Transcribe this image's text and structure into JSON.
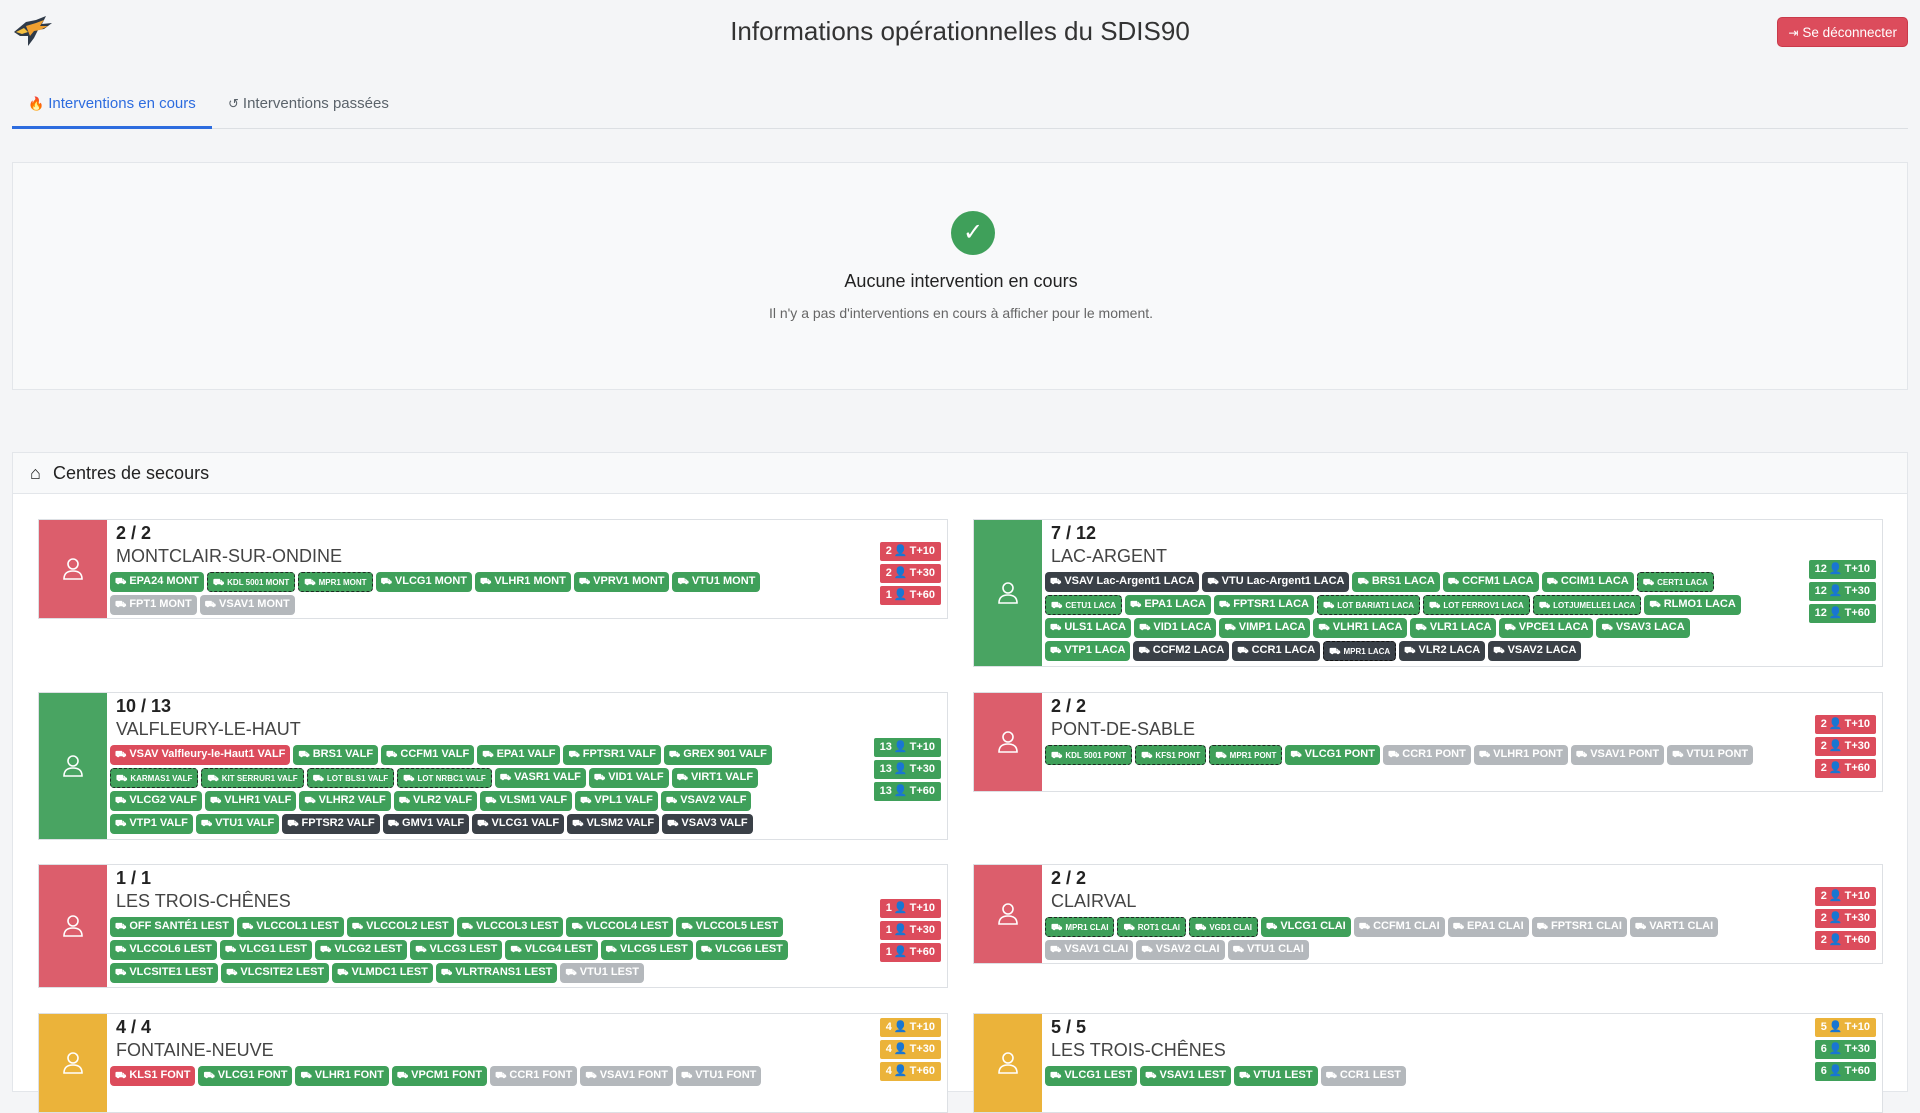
{
  "header": {
    "title": "Informations opérationnelles du SDIS90",
    "logout_label": "Se déconnecter"
  },
  "tabs": [
    {
      "label": "Interventions en cours"
    },
    {
      "label": "Interventions passées"
    }
  ],
  "empty": {
    "title": "Aucune intervention en cours",
    "subtitle": "Il n'y a pas d'interventions en cours à afficher pour le moment."
  },
  "centres": {
    "title": "Centres de secours",
    "cards": [
      {
        "count": "2 / 2",
        "name": "MONTCLAIR-SUR-ONDINE",
        "status": "red",
        "vehicles": [
          {
            "label": "EPA24 MONT",
            "color": "green"
          },
          {
            "label": "KDL 5001 MONT",
            "color": "dashed",
            "small": true
          },
          {
            "label": "MPR1 MONT",
            "color": "dashed",
            "small": true
          },
          {
            "label": "VLCG1 MONT",
            "color": "green"
          },
          {
            "label": "VLHR1 MONT",
            "color": "green"
          },
          {
            "label": "VPRV1 MONT",
            "color": "green"
          },
          {
            "label": "VTU1 MONT",
            "color": "green"
          },
          {
            "label": "FPT1 MONT",
            "color": "gray"
          },
          {
            "label": "VSAV1 MONT",
            "color": "gray"
          }
        ],
        "staff": [
          {
            "n": "2",
            "t": "T+10",
            "color": "red"
          },
          {
            "n": "2",
            "t": "T+30",
            "color": "red"
          },
          {
            "n": "1",
            "t": "T+60",
            "color": "red"
          }
        ]
      },
      {
        "count": "7 / 12",
        "name": "LAC-ARGENT",
        "status": "green",
        "vehicles": [
          {
            "label": "VSAV Lac-Argent1 LACA",
            "color": "dark"
          },
          {
            "label": "VTU Lac-Argent1 LACA",
            "color": "dark"
          },
          {
            "label": "BRS1 LACA",
            "color": "green"
          },
          {
            "label": "CCFM1 LACA",
            "color": "green"
          },
          {
            "label": "CCIM1 LACA",
            "color": "green"
          },
          {
            "label": "CERT1 LACA",
            "color": "dashed",
            "small": true
          },
          {
            "label": "CETU1 LACA",
            "color": "dashed",
            "small": true
          },
          {
            "label": "EPA1 LACA",
            "color": "green"
          },
          {
            "label": "FPTSR1 LACA",
            "color": "green"
          },
          {
            "label": "LOT BARIAT1 LACA",
            "color": "dashed",
            "small": true
          },
          {
            "label": "LOT FERROV1 LACA",
            "color": "dashed",
            "small": true
          },
          {
            "label": "LOTJUMELLE1 LACA",
            "color": "dashed",
            "small": true
          },
          {
            "label": "RLMO1 LACA",
            "color": "green"
          },
          {
            "label": "ULS1 LACA",
            "color": "green"
          },
          {
            "label": "VID1 LACA",
            "color": "green"
          },
          {
            "label": "VIMP1 LACA",
            "color": "green"
          },
          {
            "label": "VLHR1 LACA",
            "color": "green"
          },
          {
            "label": "VLR1 LACA",
            "color": "green"
          },
          {
            "label": "VPCE1 LACA",
            "color": "green"
          },
          {
            "label": "VSAV3 LACA",
            "color": "green"
          },
          {
            "label": "VTP1 LACA",
            "color": "green"
          },
          {
            "label": "CCFM2 LACA",
            "color": "dark"
          },
          {
            "label": "CCR1 LACA",
            "color": "dark"
          },
          {
            "label": "MPR1 LACA",
            "color": "dashed-dk",
            "small": true
          },
          {
            "label": "VLR2 LACA",
            "color": "dark"
          },
          {
            "label": "VSAV2 LACA",
            "color": "dark"
          }
        ],
        "staff": [
          {
            "n": "12",
            "t": "T+10",
            "color": "green"
          },
          {
            "n": "12",
            "t": "T+30",
            "color": "green"
          },
          {
            "n": "12",
            "t": "T+60",
            "color": "green"
          }
        ]
      },
      {
        "count": "10 / 13",
        "name": "VALFLEURY-LE-HAUT",
        "status": "green",
        "vehicles": [
          {
            "label": "VSAV Valfleury-le-Haut1 VALF",
            "color": "red"
          },
          {
            "label": "BRS1 VALF",
            "color": "green"
          },
          {
            "label": "CCFM1 VALF",
            "color": "green"
          },
          {
            "label": "EPA1 VALF",
            "color": "green"
          },
          {
            "label": "FPTSR1 VALF",
            "color": "green"
          },
          {
            "label": "GREX 901 VALF",
            "color": "green"
          },
          {
            "label": "KARMAS1 VALF",
            "color": "dashed",
            "small": true
          },
          {
            "label": "KIT SERRUR1 VALF",
            "color": "dashed",
            "small": true
          },
          {
            "label": "LOT BLS1 VALF",
            "color": "dashed",
            "small": true
          },
          {
            "label": "LOT NRBC1 VALF",
            "color": "dashed",
            "small": true
          },
          {
            "label": "VASR1 VALF",
            "color": "green"
          },
          {
            "label": "VID1 VALF",
            "color": "green"
          },
          {
            "label": "VIRT1 VALF",
            "color": "green"
          },
          {
            "label": "VLCG2 VALF",
            "color": "green"
          },
          {
            "label": "VLHR1 VALF",
            "color": "green"
          },
          {
            "label": "VLHR2 VALF",
            "color": "green"
          },
          {
            "label": "VLR2 VALF",
            "color": "green"
          },
          {
            "label": "VLSM1 VALF",
            "color": "green"
          },
          {
            "label": "VPL1 VALF",
            "color": "green"
          },
          {
            "label": "VSAV2 VALF",
            "color": "green"
          },
          {
            "label": "VTP1 VALF",
            "color": "green"
          },
          {
            "label": "VTU1 VALF",
            "color": "green"
          },
          {
            "label": "FPTSR2 VALF",
            "color": "dark"
          },
          {
            "label": "GMV1 VALF",
            "color": "dark"
          },
          {
            "label": "VLCG1 VALF",
            "color": "dark"
          },
          {
            "label": "VLSM2 VALF",
            "color": "dark"
          },
          {
            "label": "VSAV3 VALF",
            "color": "dark"
          }
        ],
        "staff": [
          {
            "n": "13",
            "t": "T+10",
            "color": "green"
          },
          {
            "n": "13",
            "t": "T+30",
            "color": "green"
          },
          {
            "n": "13",
            "t": "T+60",
            "color": "green"
          }
        ]
      },
      {
        "count": "2 / 2",
        "name": "PONT-DE-SABLE",
        "status": "red",
        "vehicles": [
          {
            "label": "KDL 5001 PONT",
            "color": "dashed",
            "small": true
          },
          {
            "label": "KFS1 PONT",
            "color": "dashed",
            "small": true
          },
          {
            "label": "MPR1 PONT",
            "color": "dashed",
            "small": true
          },
          {
            "label": "VLCG1 PONT",
            "color": "green"
          },
          {
            "label": "CCR1 PONT",
            "color": "gray"
          },
          {
            "label": "VLHR1 PONT",
            "color": "gray"
          },
          {
            "label": "VSAV1 PONT",
            "color": "gray"
          },
          {
            "label": "VTU1 PONT",
            "color": "gray"
          }
        ],
        "staff": [
          {
            "n": "2",
            "t": "T+10",
            "color": "red"
          },
          {
            "n": "2",
            "t": "T+30",
            "color": "red"
          },
          {
            "n": "2",
            "t": "T+60",
            "color": "red"
          }
        ]
      },
      {
        "count": "1 / 1",
        "name": "LES TROIS-CHÊNES",
        "status": "red",
        "vehicles": [
          {
            "label": "OFF SANTÉ1 LEST",
            "color": "green"
          },
          {
            "label": "VLCCOL1 LEST",
            "color": "green"
          },
          {
            "label": "VLCCOL2 LEST",
            "color": "green"
          },
          {
            "label": "VLCCOL3 LEST",
            "color": "green"
          },
          {
            "label": "VLCCOL4 LEST",
            "color": "green"
          },
          {
            "label": "VLCCOL5 LEST",
            "color": "green"
          },
          {
            "label": "VLCCOL6 LEST",
            "color": "green"
          },
          {
            "label": "VLCG1 LEST",
            "color": "green"
          },
          {
            "label": "VLCG2 LEST",
            "color": "green"
          },
          {
            "label": "VLCG3 LEST",
            "color": "green"
          },
          {
            "label": "VLCG4 LEST",
            "color": "green"
          },
          {
            "label": "VLCG5 LEST",
            "color": "green"
          },
          {
            "label": "VLCG6 LEST",
            "color": "green"
          },
          {
            "label": "VLCSITE1 LEST",
            "color": "green"
          },
          {
            "label": "VLCSITE2 LEST",
            "color": "green"
          },
          {
            "label": "VLMDC1 LEST",
            "color": "green"
          },
          {
            "label": "VLRTRANS1 LEST",
            "color": "green"
          },
          {
            "label": "VTU1 LEST",
            "color": "gray"
          }
        ],
        "staff": [
          {
            "n": "1",
            "t": "T+10",
            "color": "red"
          },
          {
            "n": "1",
            "t": "T+30",
            "color": "red"
          },
          {
            "n": "1",
            "t": "T+60",
            "color": "red"
          }
        ]
      },
      {
        "count": "2 / 2",
        "name": "CLAIRVAL",
        "status": "red",
        "vehicles": [
          {
            "label": "MPR1 CLAI",
            "color": "dashed",
            "small": true
          },
          {
            "label": "ROT1 CLAI",
            "color": "dashed",
            "small": true
          },
          {
            "label": "VGD1 CLAI",
            "color": "dashed",
            "small": true
          },
          {
            "label": "VLCG1 CLAI",
            "color": "green"
          },
          {
            "label": "CCFM1 CLAI",
            "color": "gray"
          },
          {
            "label": "EPA1 CLAI",
            "color": "gray"
          },
          {
            "label": "FPTSR1 CLAI",
            "color": "gray"
          },
          {
            "label": "VART1 CLAI",
            "color": "gray"
          },
          {
            "label": "VSAV1 CLAI",
            "color": "gray"
          },
          {
            "label": "VSAV2 CLAI",
            "color": "gray"
          },
          {
            "label": "VTU1 CLAI",
            "color": "gray"
          }
        ],
        "staff": [
          {
            "n": "2",
            "t": "T+10",
            "color": "red"
          },
          {
            "n": "2",
            "t": "T+30",
            "color": "red"
          },
          {
            "n": "2",
            "t": "T+60",
            "color": "red"
          }
        ]
      },
      {
        "count": "4 / 4",
        "name": "FONTAINE-NEUVE",
        "status": "orange",
        "vehicles": [
          {
            "label": "KLS1 FONT",
            "color": "red"
          },
          {
            "label": "VLCG1 FONT",
            "color": "green"
          },
          {
            "label": "VLHR1 FONT",
            "color": "green"
          },
          {
            "label": "VPCM1 FONT",
            "color": "green"
          },
          {
            "label": "CCR1 FONT",
            "color": "gray"
          },
          {
            "label": "VSAV1 FONT",
            "color": "gray"
          },
          {
            "label": "VTU1 FONT",
            "color": "gray"
          }
        ],
        "staff": [
          {
            "n": "4",
            "t": "T+10",
            "color": "orange"
          },
          {
            "n": "4",
            "t": "T+30",
            "color": "orange"
          },
          {
            "n": "4",
            "t": "T+60",
            "color": "orange"
          }
        ]
      },
      {
        "count": "5 / 5",
        "name": "LES TROIS-CHÊNES",
        "status": "orange",
        "vehicles": [
          {
            "label": "VLCG1 LEST",
            "color": "green"
          },
          {
            "label": "VSAV1 LEST",
            "color": "green"
          },
          {
            "label": "VTU1 LEST",
            "color": "green"
          },
          {
            "label": "CCR1 LEST",
            "color": "gray"
          }
        ],
        "staff": [
          {
            "n": "5",
            "t": "T+10",
            "color": "orange"
          },
          {
            "n": "6",
            "t": "T+30",
            "color": "green"
          },
          {
            "n": "6",
            "t": "T+60",
            "color": "green"
          }
        ]
      }
    ]
  }
}
